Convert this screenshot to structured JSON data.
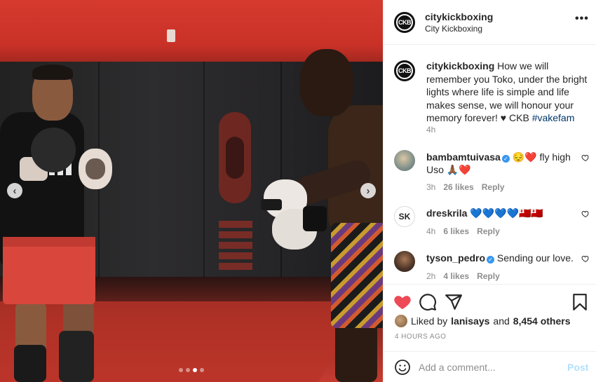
{
  "post": {
    "username": "citykickboxing",
    "location": "City Kickboxing",
    "avatar_text": "CKB",
    "more_icon": "more-horizontal-icon",
    "caption": {
      "text": "How we will remember you Toko, under the bright lights where life is simple and life makes sense, we will honour your memory forever! ♥ CKB",
      "hashtag": "#vakefam",
      "time": "4h"
    }
  },
  "comments": [
    {
      "username": "bambamtuivasa",
      "verified": true,
      "text": "😔❤️ fly high Uso 🙏🏾❤️",
      "time": "3h",
      "likes": "26 likes",
      "reply": "Reply"
    },
    {
      "username": "dreskrila",
      "verified": false,
      "text": "💙💙💙💙🇹🇴🇹🇴",
      "time": "4h",
      "likes": "6 likes",
      "reply": "Reply"
    },
    {
      "username": "tyson_pedro",
      "verified": true,
      "text": "Sending our love.",
      "time": "2h",
      "likes": "4 likes",
      "reply": "Reply"
    }
  ],
  "actions": {
    "like_icon": "heart-filled-icon",
    "comment_icon": "comment-icon",
    "share_icon": "share-icon",
    "save_icon": "bookmark-icon",
    "liked_by_prefix": "Liked by",
    "liked_by_user": "lanisays",
    "liked_by_and": "and",
    "liked_by_others": "8,454 others",
    "date": "4 HOURS AGO"
  },
  "add_comment": {
    "placeholder": "Add a comment...",
    "post_label": "Post"
  },
  "media": {
    "prev_label": "‹",
    "next_label": "›",
    "slide_count": 4,
    "active_slide": 3
  },
  "colors": {
    "like_red": "#ed4956",
    "link_blue": "#00376b",
    "verified_blue": "#3897f0",
    "post_disabled": "#b2dffc",
    "muted": "#8e8e8e"
  }
}
